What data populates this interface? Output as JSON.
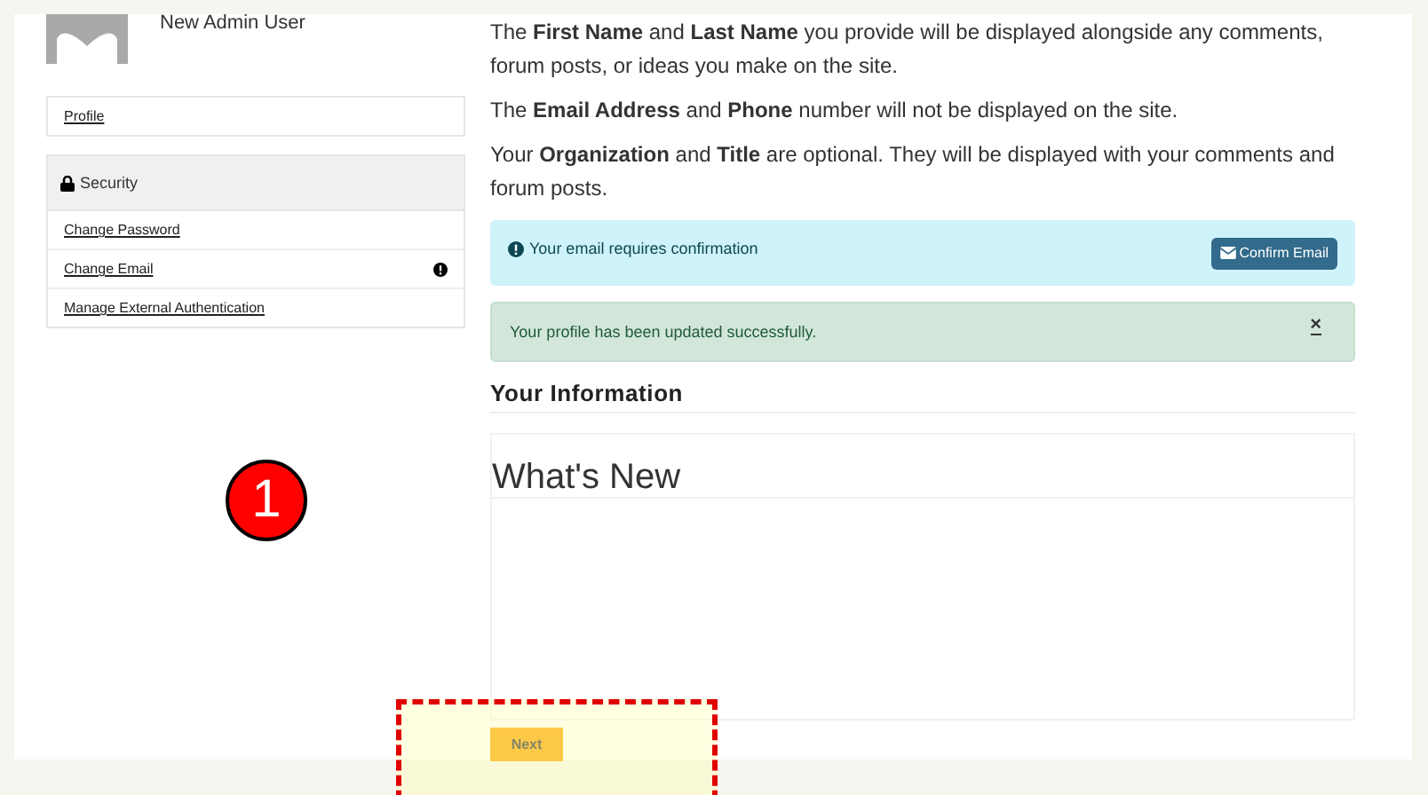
{
  "user": {
    "name": "New Admin User"
  },
  "sidebar": {
    "profile_link": "Profile",
    "security": {
      "title": "Security",
      "items": [
        {
          "label": "Change Password",
          "alert": false
        },
        {
          "label": "Change Email",
          "alert": true
        },
        {
          "label": "Manage External Authentication",
          "alert": false
        }
      ]
    }
  },
  "intro": [
    "The **First Name** and **Last Name** you provide will be displayed alongside any comments, forum posts, or ideas you make on the site.",
    "The **Email Address** and **Phone** number will not be displayed on the site.",
    "Your **Organization** and **Title** are optional. They will be displayed with your comments and forum posts."
  ],
  "alerts": [
    {
      "kind": "info",
      "text": "Your email requires confirmation",
      "button": "Confirm Email"
    },
    {
      "kind": "success",
      "text": "Your profile has been updated successfully.",
      "close": "×"
    }
  ],
  "section_title": "Your Information",
  "panel": {
    "title": "What's New"
  },
  "next_button": "Next",
  "annotation": {
    "number": "1"
  }
}
